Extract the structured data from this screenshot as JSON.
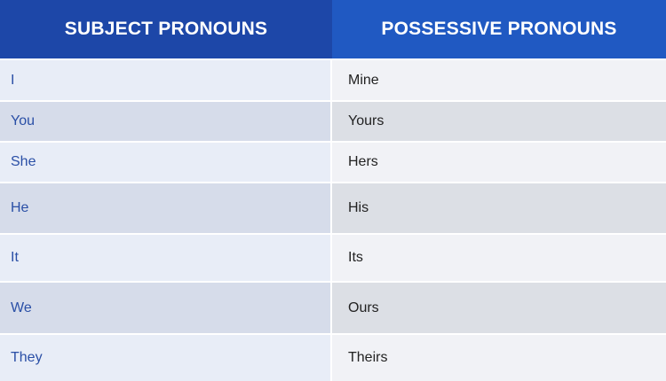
{
  "table": {
    "headers": {
      "subject": "SUBJECT PRONOUNS",
      "possessive": "POSSESSIVE PRONOUNS"
    },
    "rows": [
      {
        "subject": "I",
        "possessive": "Mine"
      },
      {
        "subject": "You",
        "possessive": "Yours"
      },
      {
        "subject": "She",
        "possessive": "Hers"
      },
      {
        "subject": "He",
        "possessive": "His"
      },
      {
        "subject": "It",
        "possessive": "Its"
      },
      {
        "subject": "We",
        "possessive": "Ours"
      },
      {
        "subject": "They",
        "possessive": "Theirs"
      }
    ]
  },
  "colors": {
    "header_left": "#1d47a8",
    "header_right": "#2059c2",
    "subject_text": "#2a4fa6",
    "possessive_text": "#222222"
  }
}
